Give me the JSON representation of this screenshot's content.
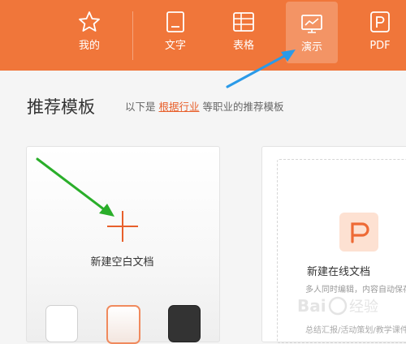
{
  "nav": {
    "items": [
      {
        "label": "我的",
        "icon": "star-icon"
      },
      {
        "label": "文字",
        "icon": "document-icon"
      },
      {
        "label": "表格",
        "icon": "table-icon"
      },
      {
        "label": "演示",
        "icon": "presentation-icon",
        "active": true
      },
      {
        "label": "PDF",
        "icon": "pdf-icon"
      }
    ]
  },
  "header": {
    "title": "推荐模板",
    "subtitle_prefix": "以下是",
    "subtitle_link": "根据行业",
    "subtitle_suffix": "等职业的推荐模板"
  },
  "cards": {
    "blank": {
      "label": "新建空白文档",
      "icon": "plus-icon"
    },
    "online": {
      "label": "新建在线文档",
      "icon": "pdf-p-icon",
      "desc": "多人同时编辑，内容自动保存",
      "desc2": "总结汇报/活动策划/教学课件"
    }
  },
  "colors": {
    "topbar": "#f0763a",
    "accent": "#e8602c",
    "annotation_blue": "#2a9ae8",
    "annotation_green": "#2aae2a"
  }
}
